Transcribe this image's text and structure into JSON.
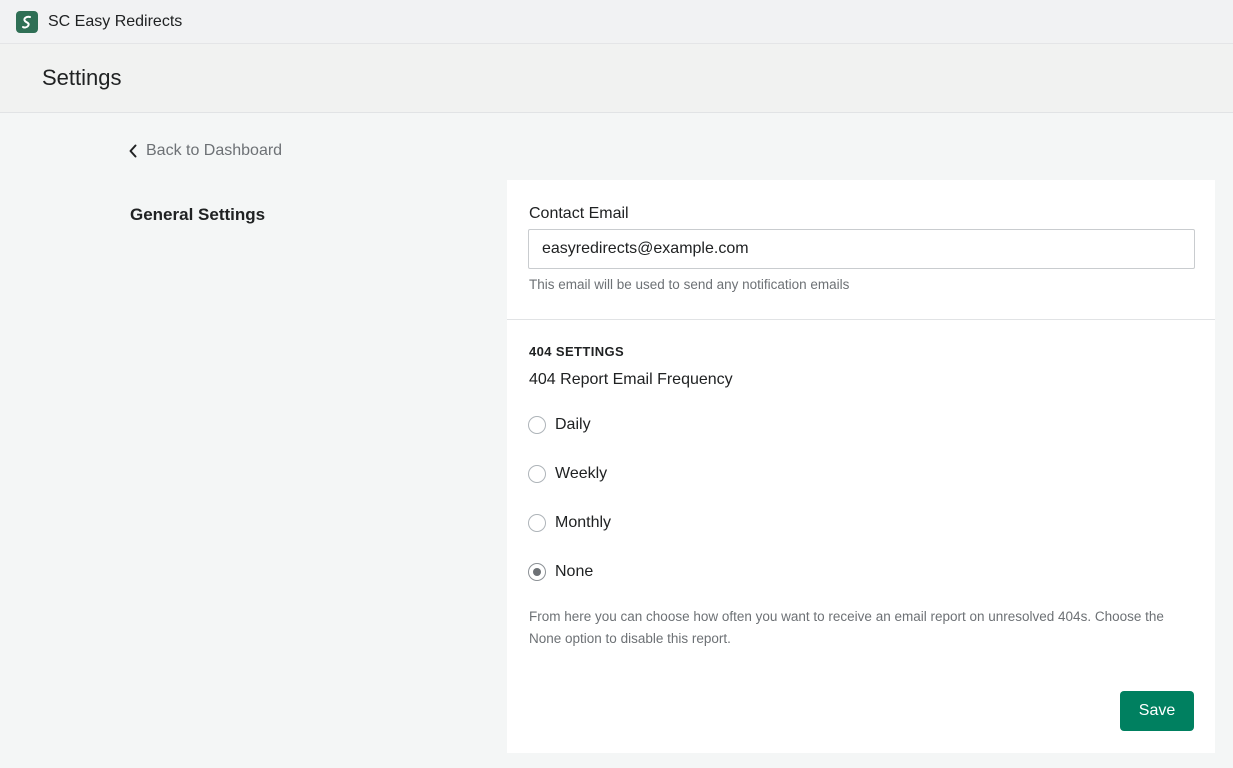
{
  "app": {
    "title": "SC Easy Redirects",
    "logo_icon": "app-logo-icon"
  },
  "page": {
    "title": "Settings"
  },
  "nav": {
    "back_label": "Back to Dashboard"
  },
  "section": {
    "title": "General Settings"
  },
  "contact": {
    "label": "Contact Email",
    "value": "easyredirects@example.com",
    "help": "This email will be used to send any notification emails"
  },
  "report": {
    "heading": "404 SETTINGS",
    "frequency_label": "404 Report Email Frequency",
    "options": [
      {
        "label": "Daily",
        "checked": false
      },
      {
        "label": "Weekly",
        "checked": false
      },
      {
        "label": "Monthly",
        "checked": false
      },
      {
        "label": "None",
        "checked": true
      }
    ],
    "selected": "None",
    "description": "From here you can choose how often you want to receive an email report on unresolved 404s. Choose the None option to disable this report."
  },
  "actions": {
    "save_label": "Save"
  },
  "colors": {
    "primary": "#008060",
    "logo": "#2f6f55"
  }
}
